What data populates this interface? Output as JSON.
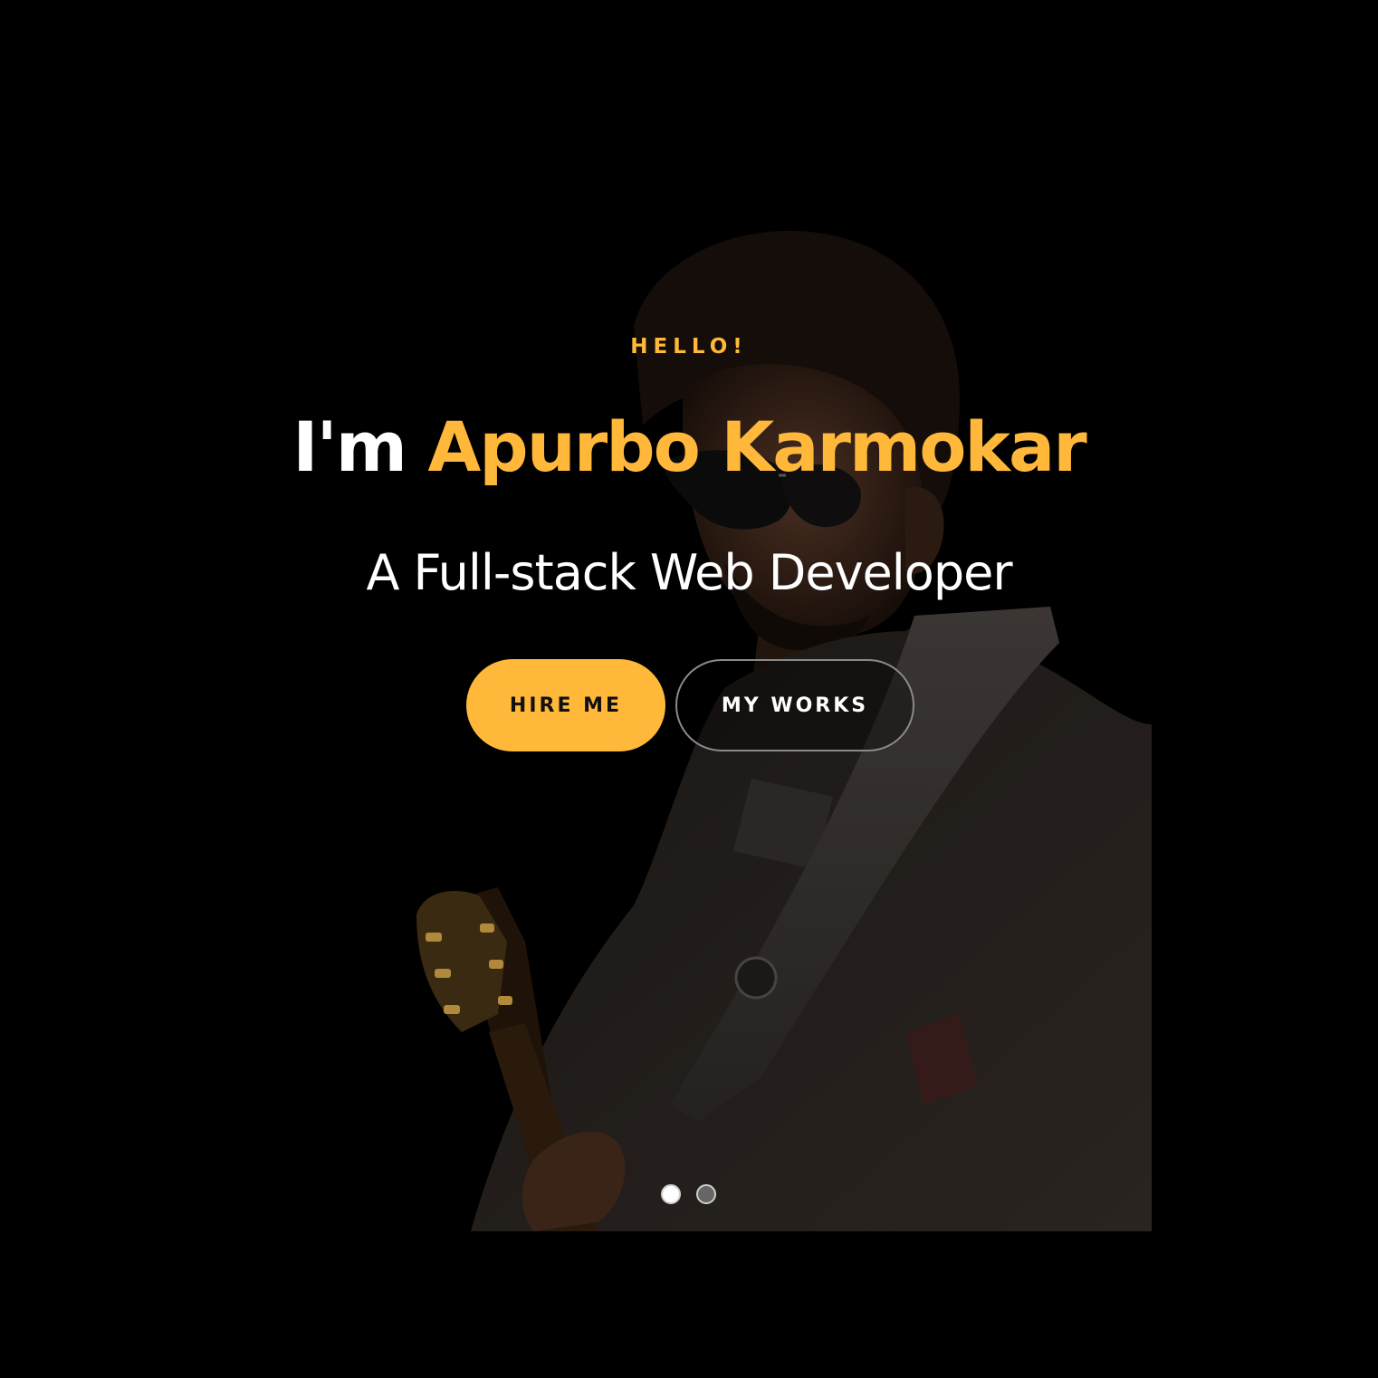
{
  "hero": {
    "greeting": "HELLO!",
    "headline_prefix": "I'm",
    "headline_name": "Apurbo Karmokar",
    "subtitle": "A Full-stack Web Developer",
    "background": "photo of a man with sunglasses playing guitar"
  },
  "buttons": {
    "hire_label": "HIRE ME",
    "works_label": "MY WORKS"
  },
  "slider": {
    "total_slides": 2,
    "active_slide": 1
  },
  "colors": {
    "accent": "#FFB83A",
    "background": "#000000",
    "text": "#FFFFFF"
  }
}
